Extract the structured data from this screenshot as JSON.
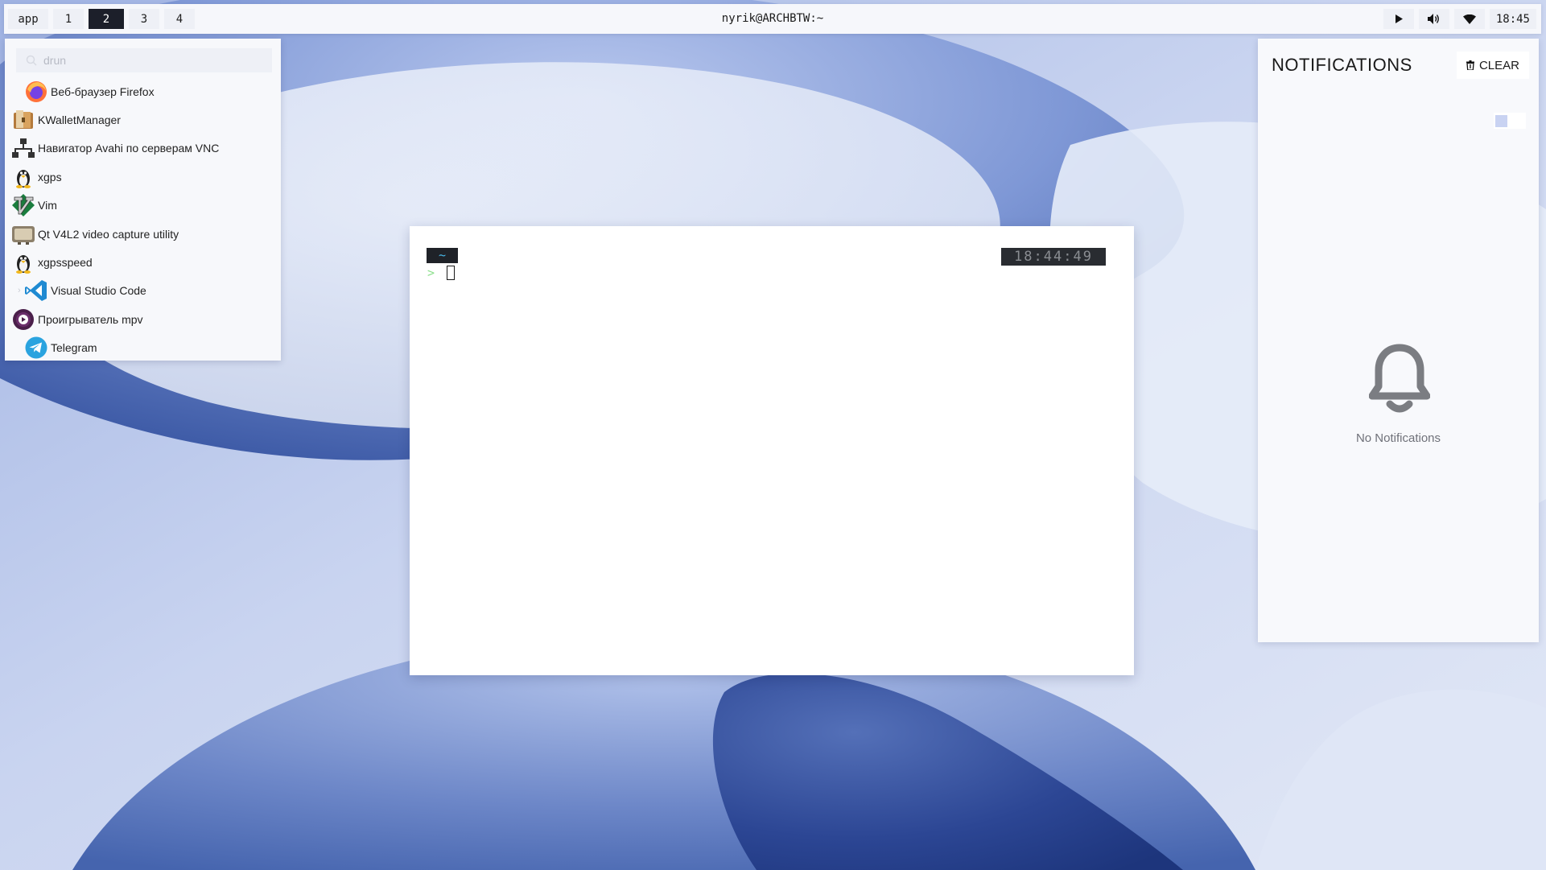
{
  "topbar": {
    "workspaces": [
      "app",
      "1",
      "2",
      "3",
      "4"
    ],
    "active_workspace": "2",
    "window_title": "nyrik@ARCHBTW:~",
    "tray_icons": [
      "play-icon",
      "volume-icon",
      "wifi-icon"
    ],
    "clock": "18:45"
  },
  "launcher": {
    "mode": "drun",
    "search_placeholder": "drun",
    "items": [
      {
        "label": "Веб-браузер Firefox",
        "icon": "firefox-icon"
      },
      {
        "label": "KWalletManager",
        "icon": "kwallet-icon"
      },
      {
        "label": "Навигатор Avahi по серверам VNC",
        "icon": "network-icon"
      },
      {
        "label": "xgps",
        "icon": "tux-icon"
      },
      {
        "label": "Vim",
        "icon": "vim-icon"
      },
      {
        "label": "Qt V4L2 video capture utility",
        "icon": "tv-icon"
      },
      {
        "label": "xgpsspeed",
        "icon": "tux-icon"
      },
      {
        "label": "Visual Studio Code",
        "icon": "vscode-icon"
      },
      {
        "label": "Проигрыватель mpv",
        "icon": "mpv-icon"
      },
      {
        "label": "Telegram",
        "icon": "telegram-icon"
      }
    ]
  },
  "terminal": {
    "directory": "~",
    "prompt": ">",
    "time": "18:44:49"
  },
  "notifications": {
    "title": "NOTIFICATIONS",
    "clear_label": "CLEAR",
    "empty_text": "No Notifications"
  },
  "colors": {
    "accent": "#1c1f2a",
    "prompt_green": "#8ee08e",
    "dir_blue": "#48b8e8",
    "wallpaper_blue": "#5a76b8"
  }
}
